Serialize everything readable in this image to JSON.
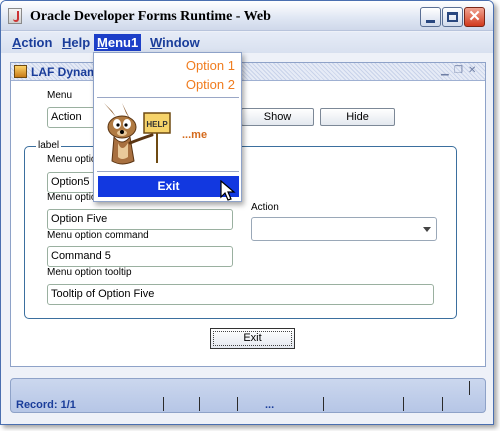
{
  "window": {
    "title": "Oracle Developer Forms Runtime - Web",
    "close_glyph": "✕"
  },
  "menubar": {
    "items": [
      {
        "label": "Action",
        "mnemonic": "A"
      },
      {
        "label": "Help",
        "mnemonic": "H"
      },
      {
        "label": "Menu1",
        "mnemonic": "M"
      },
      {
        "label": "Window",
        "mnemonic": "W"
      }
    ],
    "active_index": 2
  },
  "popup": {
    "options": [
      "Option 1",
      "Option 2"
    ],
    "help_sign": "HELP",
    "help_text": "...me",
    "exit_label": "Exit"
  },
  "inner_window": {
    "title": "LAF Dynam"
  },
  "form": {
    "menu_label": "Menu",
    "menu_value": "Action",
    "show_button": "Show",
    "hide_button": "Hide",
    "group_label": "label",
    "menu_option_label": "Menu option",
    "menu_option_value": "Option5",
    "menu_option_label_label": "Menu option label",
    "menu_option_label_value": "Option Five",
    "menu_option_command_label": "Menu option command",
    "menu_option_command_value": "Command 5",
    "menu_option_tooltip_label": "Menu option tooltip",
    "menu_option_tooltip_value": "Tooltip of Option Five",
    "action_label": "Action",
    "action_value": "",
    "exit_button": "Exit"
  },
  "statusbar": {
    "record": "Record: 1/1",
    "dots": "..."
  },
  "colors": {
    "menu_text": "#1a3d9a",
    "menu_active_bg": "#1d3fc8",
    "popup_option": "#f07c1e",
    "popup_exit_bg": "#1238e0"
  }
}
